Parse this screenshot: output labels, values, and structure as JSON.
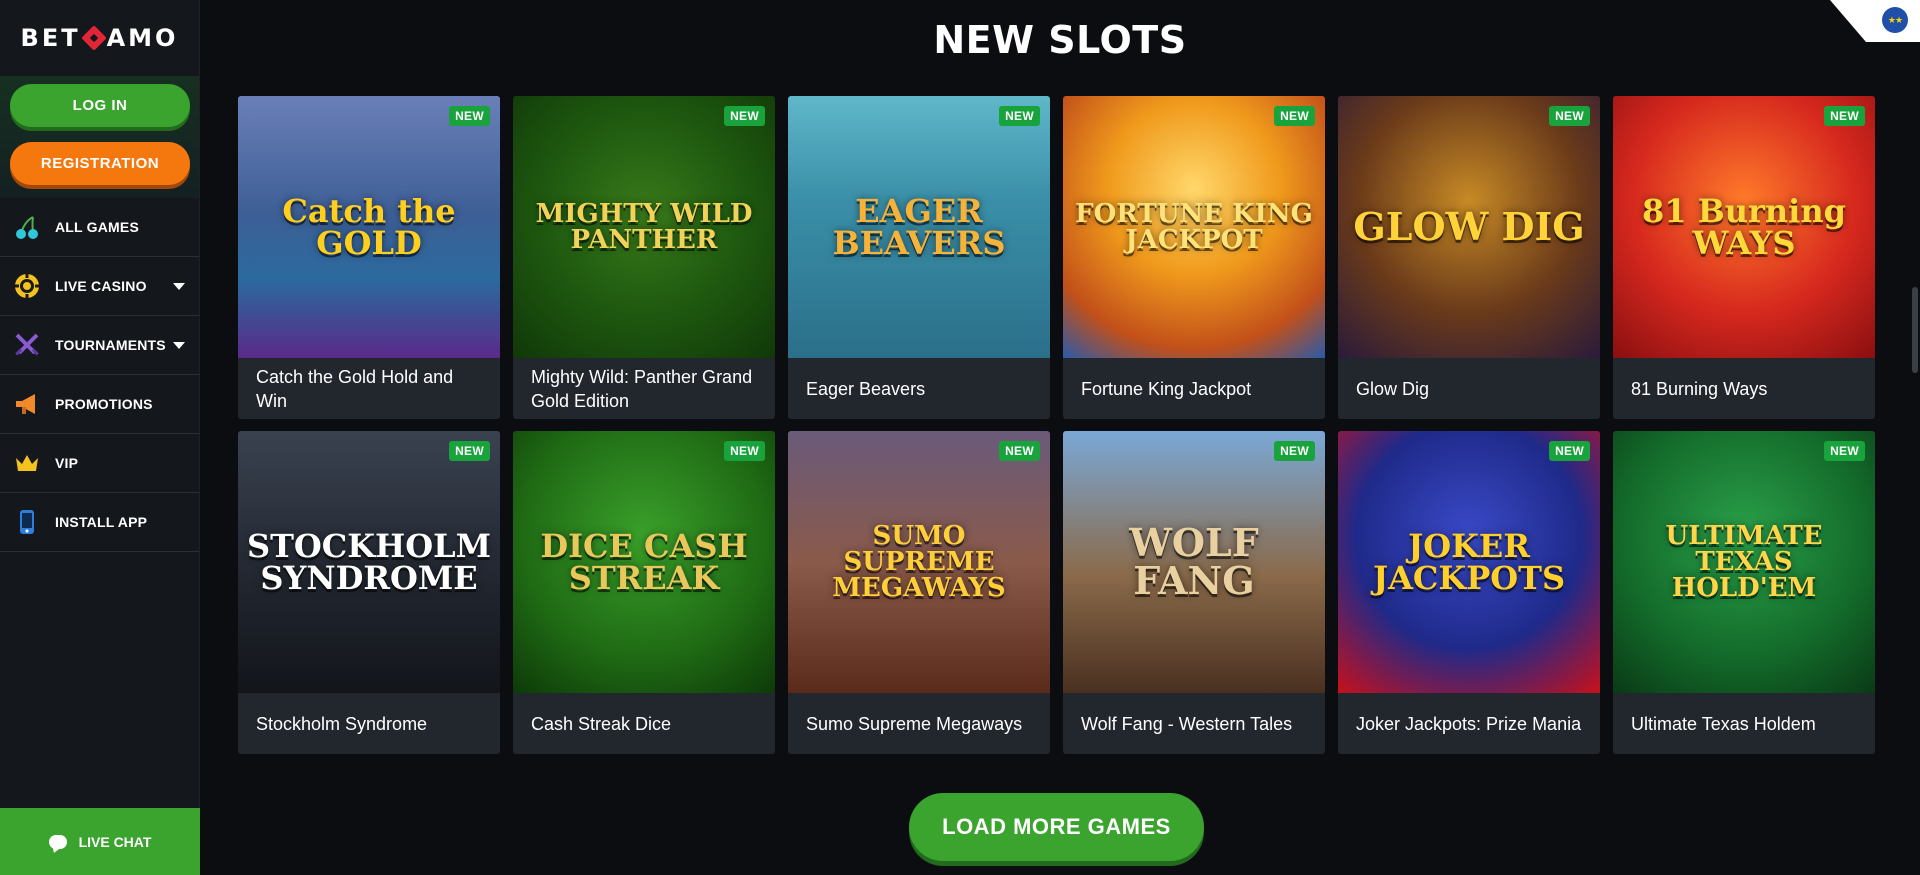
{
  "logo": {
    "left": "BET",
    "right": "AMO"
  },
  "auth": {
    "login_label": "LOG IN",
    "register_label": "REGISTRATION"
  },
  "nav": [
    {
      "label": "ALL GAMES",
      "icon": "cherries-icon",
      "has_caret": false
    },
    {
      "label": "LIVE CASINO",
      "icon": "poker-chip-icon",
      "has_caret": true
    },
    {
      "label": "TOURNAMENTS",
      "icon": "crossed-swords-icon",
      "has_caret": true
    },
    {
      "label": "PROMOTIONS",
      "icon": "megaphone-icon",
      "has_caret": false
    },
    {
      "label": "VIP",
      "icon": "crown-icon",
      "has_caret": false
    },
    {
      "label": "INSTALL APP",
      "icon": "phone-icon",
      "has_caret": false
    }
  ],
  "live_chat": {
    "label": "LIVE CHAT",
    "icon": "chat-bubble-icon"
  },
  "section_title": "NEW SLOTS",
  "badge_label": "NEW",
  "games": [
    {
      "name": "Catch the Gold Hold and Win",
      "art": "Catch the GOLD",
      "bg": "linear-gradient(180deg,#6b7fb8 0%,#3d5f96 45%,#2b6a9e 70%,#5a2a8a 100%)",
      "fg": "#ffcf1f"
    },
    {
      "name": "Mighty Wild: Panther Grand Gold Edition",
      "art": "MIGHTY WILD PANTHER",
      "bg": "radial-gradient(circle at 50% 45%,#3a7a1a 0%,#1f5a10 50%,#103808 100%)",
      "fg": "#f1d35a"
    },
    {
      "name": "Eager Beavers",
      "art": "EAGER BEAVERS",
      "bg": "linear-gradient(180deg,#5fb7c9 0%,#3a8fa8 40%,#2b6f8a 100%)",
      "fg": "#f6b33a"
    },
    {
      "name": "Fortune King Jackpot",
      "art": "FORTUNE KING JACKPOT",
      "bg": "radial-gradient(circle at 50% 35%,#ffd76a 0%,#f09a1c 40%,#c2501a 75%,#2a5aa8 100%)",
      "fg": "#ffe27a"
    },
    {
      "name": "Glow Dig",
      "art": "GLOW DIG",
      "bg": "radial-gradient(circle at 50% 40%,#c78a25 0%,#6a3a1a 55%,#2a1a3a 100%)",
      "fg": "#ffd23a"
    },
    {
      "name": "81 Burning Ways",
      "art": "81 Burning WAYS",
      "bg": "radial-gradient(circle at 50% 40%,#ff7a2a 0%,#d6281e 55%,#8a0f10 100%)",
      "fg": "#ffd93a"
    },
    {
      "name": "Stockholm Syndrome",
      "art": "STOCKHOLM SYNDROME",
      "bg": "linear-gradient(180deg,#3a4250 0%,#20252e 60%,#12151a 100%)",
      "fg": "#ffffff"
    },
    {
      "name": "Cash Streak Dice",
      "art": "DICE CASH STREAK",
      "bg": "radial-gradient(circle at 50% 40%,#3aa02a 0%,#1f6a14 60%,#0d3a08 100%)",
      "fg": "#e8c85a"
    },
    {
      "name": "Sumo Supreme Megaways",
      "art": "SUMO SUPREME MEGAWAYS",
      "bg": "linear-gradient(180deg,#6a5a7a 0%,#8a5a4a 50%,#5a2a1a 100%)",
      "fg": "#ffcf3a"
    },
    {
      "name": "Wolf Fang - Western Tales",
      "art": "WOLF FANG",
      "bg": "linear-gradient(180deg,#7aa8d6 0%,#8a6a4a 55%,#4a3020 100%)",
      "fg": "#e8d0a0"
    },
    {
      "name": "Joker Jackpots: Prize Mania",
      "art": "JOKER JACKPOTS",
      "bg": "radial-gradient(circle at 50% 40%,#3a4ac8 0%,#1f2a8a 55%,#c8101a 100%)",
      "fg": "#ffcf2a"
    },
    {
      "name": "Ultimate Texas Holdem",
      "art": "ULTIMATE TEXAS HOLD'EM",
      "bg": "radial-gradient(circle at 50% 40%,#2aa04a 0%,#136a2a 60%,#0a3a16 100%)",
      "fg": "#ffd64a"
    }
  ],
  "load_more_label": "LOAD MORE GAMES",
  "colors": {
    "accent_green": "#3aa42f",
    "accent_orange": "#f5780f",
    "badge_green": "#19a33c",
    "bg": "#0b0d11",
    "sidebar_bg": "#14171c",
    "card_bg": "#22262d"
  }
}
